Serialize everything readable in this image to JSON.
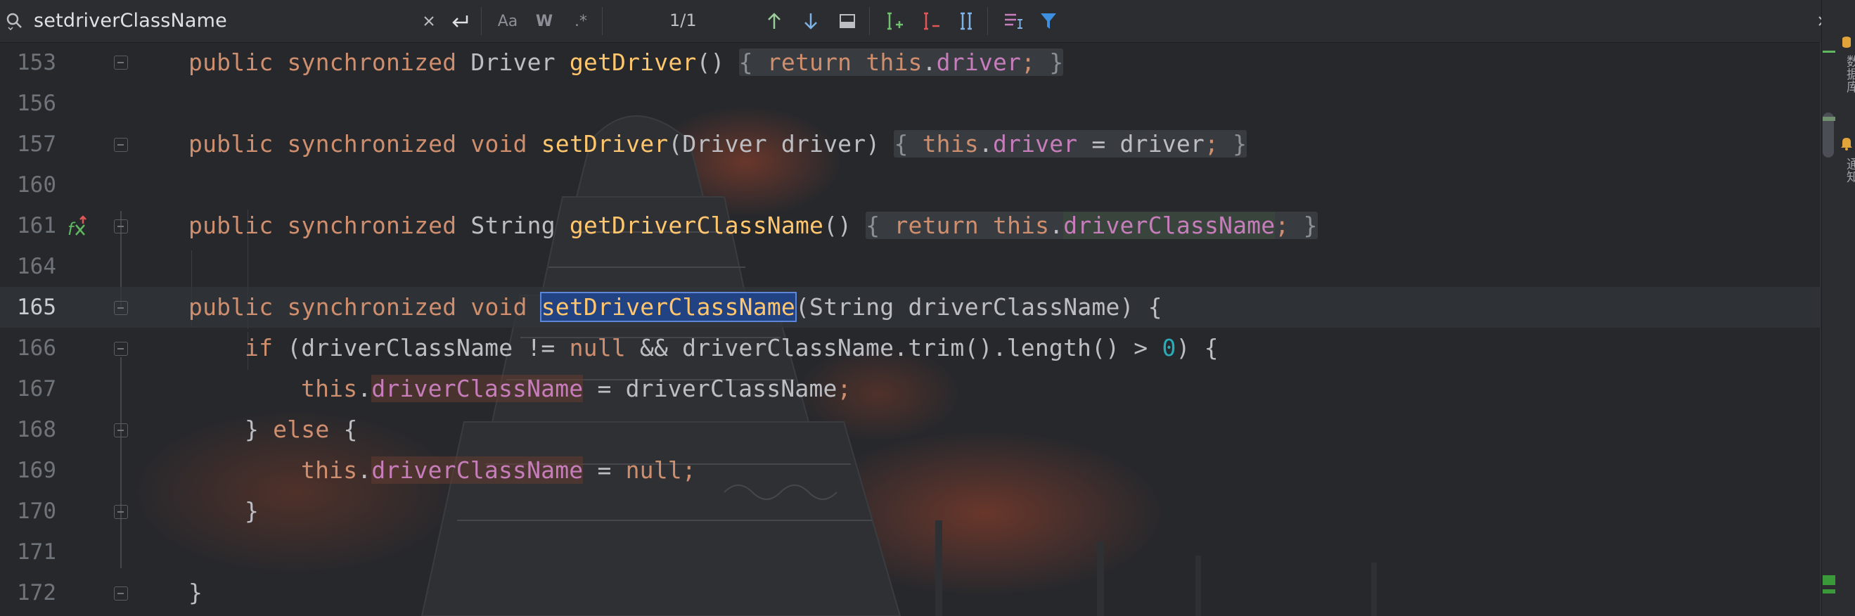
{
  "search": {
    "query": "setdriverClassName",
    "match_count": "1/1",
    "toggles": {
      "match_case": "Aa",
      "words": "W",
      "regex": ".*"
    },
    "icons": [
      "search-icon",
      "clear-icon",
      "newline-icon",
      "match-case-icon",
      "words-icon",
      "regex-icon",
      "prev-occurrence-icon",
      "next-occurrence-icon",
      "open-in-window-icon",
      "add-selection-icon",
      "remove-selection-icon",
      "select-all-icon",
      "filter-search-results-icon",
      "filter-icon",
      "close-icon"
    ]
  },
  "editor": {
    "current_line": "165",
    "lines": [
      {
        "number": "153",
        "tokens": [
          "public",
          "synchronized",
          "Driver",
          "getDriver",
          "() ",
          "{",
          "return",
          "this",
          ".",
          "driver",
          ";",
          "}"
        ]
      },
      {
        "number": "156",
        "tokens": []
      },
      {
        "number": "157",
        "tokens": [
          "public",
          "synchronized",
          "void",
          "setDriver",
          "(Driver driver) ",
          "{",
          "this",
          ".",
          "driver",
          " = driver",
          ";",
          "}"
        ]
      },
      {
        "number": "160",
        "tokens": []
      },
      {
        "number": "161",
        "tokens": [
          "public",
          "synchronized",
          "String",
          "getDriverClassName",
          "() ",
          "{",
          "return",
          "this",
          ".",
          "driverClassName",
          ";",
          "}"
        ]
      },
      {
        "number": "164",
        "tokens": []
      },
      {
        "number": "165",
        "tokens": [
          "public",
          "synchronized",
          "void",
          "setDriverClassName",
          "(String driverClassName) {"
        ]
      },
      {
        "number": "166",
        "tokens": [
          "if",
          "(driverClassName != ",
          "null",
          " && driverClassName.trim().length() > ",
          "0",
          ") {"
        ]
      },
      {
        "number": "167",
        "tokens": [
          "this",
          ".",
          "driverClassName",
          " = driverClassName",
          ";"
        ]
      },
      {
        "number": "168",
        "tokens": [
          "} ",
          "else",
          " {"
        ]
      },
      {
        "number": "169",
        "tokens": [
          "this",
          ".",
          "driverClassName",
          " = ",
          "null",
          ";"
        ]
      },
      {
        "number": "170",
        "tokens": [
          "}"
        ]
      },
      {
        "number": "171",
        "tokens": []
      },
      {
        "number": "172",
        "tokens": [
          "}"
        ]
      }
    ]
  },
  "gutter": {
    "icon": "overriding-method-icon",
    "line": "161"
  },
  "right_strip": {
    "labels": [
      "数据库",
      "通知"
    ]
  },
  "colors": {
    "keyword": "#cf8e6d",
    "function_decl": "#ffc66d",
    "field": "#c77dbb",
    "number": "#2aacb8",
    "plain": "#bcbec4",
    "selection": "#214283"
  }
}
